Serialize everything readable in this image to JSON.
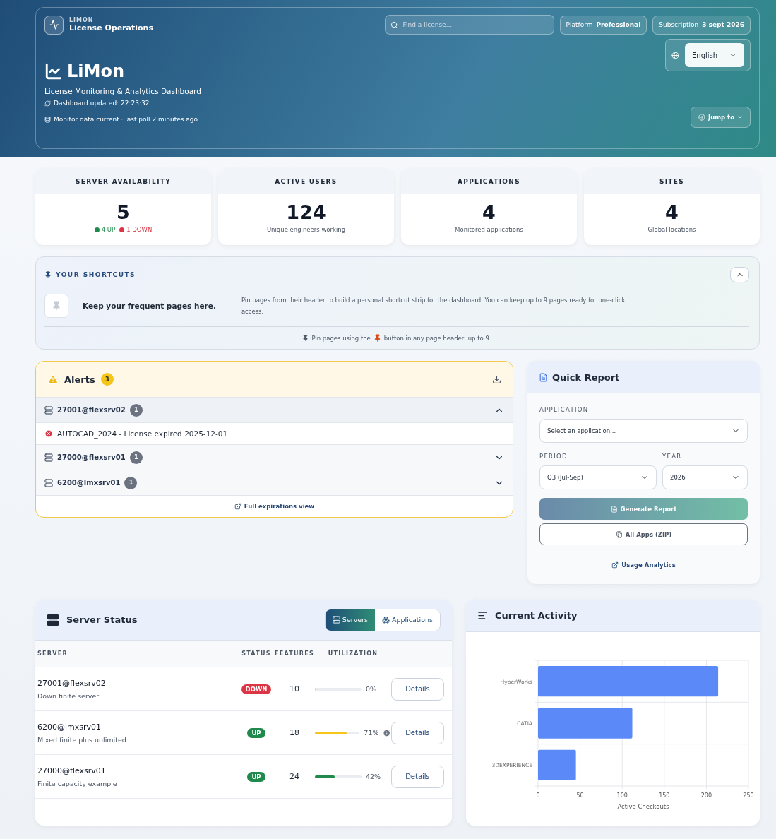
{
  "header": {
    "brand_small": "LIMON",
    "brand_name": "License Operations",
    "search": {
      "placeholder": "Find a license..."
    },
    "chips": [
      {
        "label": "Platform",
        "value": "Professional"
      },
      {
        "label": "Subscription",
        "value": "3 sept 2026"
      }
    ],
    "language": "English",
    "title": "LiMon",
    "subtitle": "License Monitoring & Analytics Dashboard",
    "updated": "Dashboard updated: 22:23:32",
    "poll": "Monitor data current · last poll 2 minutes ago",
    "jump": "Jump to"
  },
  "stats": [
    {
      "label": "SERVER AVAILABILITY",
      "value": "5",
      "kind": "updown",
      "up": "4 UP",
      "down": "1 DOWN"
    },
    {
      "label": "ACTIVE USERS",
      "value": "124",
      "kind": "text",
      "note": "Unique engineers working"
    },
    {
      "label": "APPLICATIONS",
      "value": "4",
      "kind": "text",
      "note": "Monitored applications"
    },
    {
      "label": "SITES",
      "value": "4",
      "kind": "text",
      "note": "Global locations"
    }
  ],
  "shortcuts": {
    "title": "YOUR SHORTCUTS",
    "expanded": true,
    "lead": "Keep your frequent pages here.",
    "text": "Pin pages from their header to build a personal shortcut strip for the dashboard. You can keep up to 9 pages ready for one-click access.",
    "hint_before": "Pin pages using the",
    "hint_after": "button in any page header, up to 9."
  },
  "alerts": {
    "title": "Alerts",
    "count": "3",
    "groups": [
      {
        "server": "27001@flexsrv02",
        "count": "1",
        "expanded": true,
        "items": [
          "AUTOCAD_2024 - License expired 2025-12-01"
        ]
      },
      {
        "server": "27000@flexsrv01",
        "count": "1",
        "expanded": false
      },
      {
        "server": "6200@lmxsrv01",
        "count": "1",
        "expanded": false
      }
    ],
    "link": "Full expirations view"
  },
  "quick_report": {
    "title": "Quick Report",
    "application_label": "APPLICATION",
    "application": "Select an application...",
    "period_label": "PERIOD",
    "period": "Q3 (Jul-Sep)",
    "year_label": "YEAR",
    "year": "2026",
    "generate": "Generate Report",
    "zip": "All Apps (ZIP)",
    "link": "Usage Analytics"
  },
  "server_status": {
    "title": "Server Status",
    "tabs": [
      {
        "label": "Servers",
        "selected": true
      },
      {
        "label": "Applications",
        "selected": false
      }
    ],
    "columns": [
      "SERVER",
      "STATUS",
      "FEATURES",
      "UTILIZATION"
    ],
    "rows": [
      {
        "server": "27001@flexsrv02",
        "description": "Down finite server",
        "status": "DOWN",
        "kind": "down",
        "features": "10",
        "level": 0,
        "utilization": "0%",
        "info": false,
        "action": "Details"
      },
      {
        "server": "6200@lmxsrv01",
        "description": "Mixed finite plus unlimited",
        "status": "UP",
        "kind": "up",
        "features": "18",
        "level": 0.71,
        "color": "#f5c518",
        "utilization": "71%",
        "info": true,
        "action": "Details"
      },
      {
        "server": "27000@flexsrv01",
        "description": "Finite capacity example",
        "status": "UP",
        "kind": "up",
        "features": "24",
        "level": 0.42,
        "color": "#1f8a4c",
        "utilization": "42%",
        "info": false,
        "action": "Details"
      }
    ]
  },
  "activity": {
    "title": "Current Activity",
    "chart_data": {
      "type": "bar",
      "orientation": "horizontal",
      "xlabel": "Active Checkouts",
      "categories": [
        "HyperWorks",
        "CATIA",
        "3DEXPERIENCE"
      ],
      "series": [
        {
          "color": "#5b8af8",
          "values": [
            214,
            112,
            45
          ]
        }
      ],
      "grid": true,
      "xlim": [
        0,
        250
      ],
      "xticks": [
        0,
        50,
        100,
        150,
        200,
        250
      ]
    }
  }
}
